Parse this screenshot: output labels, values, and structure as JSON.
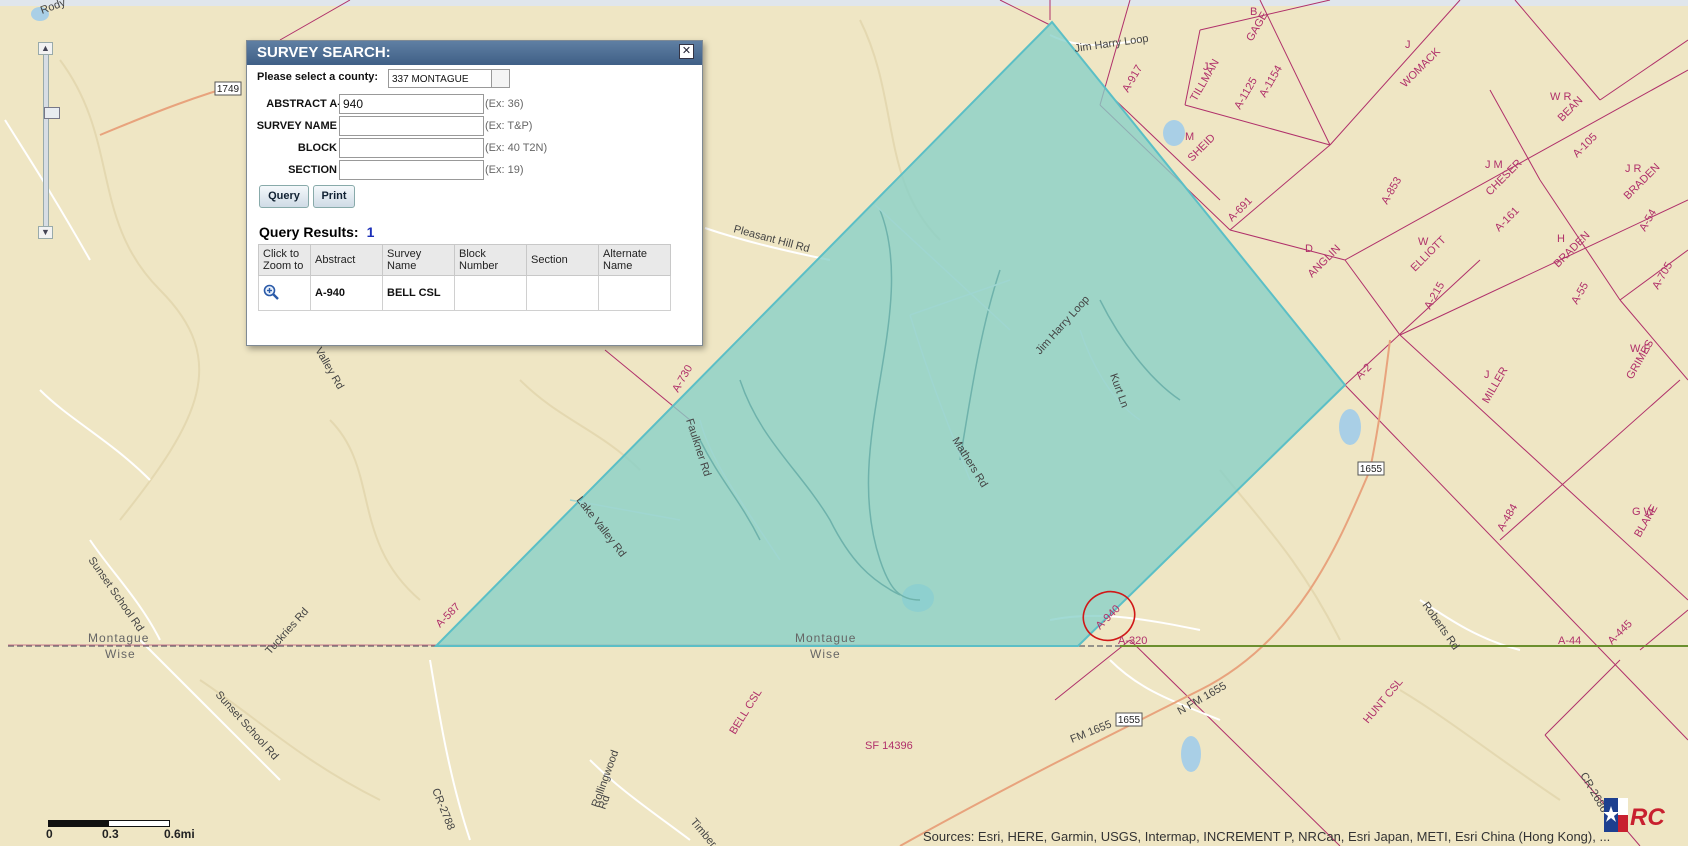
{
  "dialog": {
    "title": "SURVEY SEARCH:",
    "county_label": "Please select a county:",
    "county_value": "337 MONTAGUE",
    "fields": [
      {
        "label": "ABSTRACT A-",
        "value": "940",
        "hint": "(Ex: 36)"
      },
      {
        "label": "SURVEY NAME",
        "value": "",
        "hint": "(Ex: T&P)"
      },
      {
        "label": "BLOCK",
        "value": "",
        "hint": "(Ex: 40 T2N)"
      },
      {
        "label": "SECTION",
        "value": "",
        "hint": "(Ex: 19)"
      }
    ],
    "query_button": "Query",
    "print_button": "Print",
    "results_title": "Query Results:",
    "results_count": "1",
    "table": {
      "headers": [
        "Click to Zoom to",
        "Abstract",
        "Survey Name",
        "Block Number",
        "Section",
        "Alternate Name"
      ],
      "rows": [
        {
          "abstract": "A-940",
          "survey_name": "BELL CSL",
          "block_number": "",
          "section": "",
          "alternate_name": ""
        }
      ]
    }
  },
  "map": {
    "roads": [
      "Rody",
      "Jim Harry Loop",
      "Pleasant Hill Rd",
      "Lake Valley Rd",
      "Faulkner Rd",
      "Mathers Rd",
      "Jim Harry Loop",
      "Kurt Ln",
      "Sunset School Rd",
      "Tuckries Rd",
      "Sunset School Rd",
      "Roberts Rd",
      "FM 1655",
      "N FM 1655",
      "CR-2788",
      "Rollingwood Rd",
      "Timber",
      "CR-2686",
      "Valley Rd"
    ],
    "shields": [
      "1749",
      "1655",
      "1655"
    ],
    "county_labels": [
      "Montague",
      "Wise",
      "Montague",
      "Wise"
    ],
    "surveys": [
      "B GAGE",
      "J TILLMAN",
      "A-1125",
      "A-1154",
      "J WOMACK",
      "M SHEID",
      "A-917",
      "W R BEAN",
      "J M CHESER",
      "A-105",
      "J R BRADEN",
      "A-691",
      "A-853",
      "D ANGLIN",
      "W ELLIOTT",
      "A-161",
      "H BRADEN",
      "A-54",
      "A-215",
      "A-55",
      "A-705",
      "W F GRIMES",
      "A-2",
      "J MILLER",
      "A-730",
      "A-484",
      "G W BLAKE",
      "A-587",
      "A-940",
      "A-320",
      "A-44",
      "A-445",
      "BELL CSL",
      "SF 14396",
      "HUNT CSL"
    ],
    "scale": {
      "zero": "0",
      "mid": "0.3",
      "end": "0.6mi"
    },
    "attribution": "Sources: Esri, HERE, Garmin, USGS, Intermap, INCREMENT P, NRCan, Esri Japan, METI, Esri China (Hong Kong), ...",
    "colors": {
      "land": "#efe6c4",
      "highlight": "#86cfc8",
      "survey_lines": "#b0306a",
      "annotation": "#d01818"
    }
  }
}
